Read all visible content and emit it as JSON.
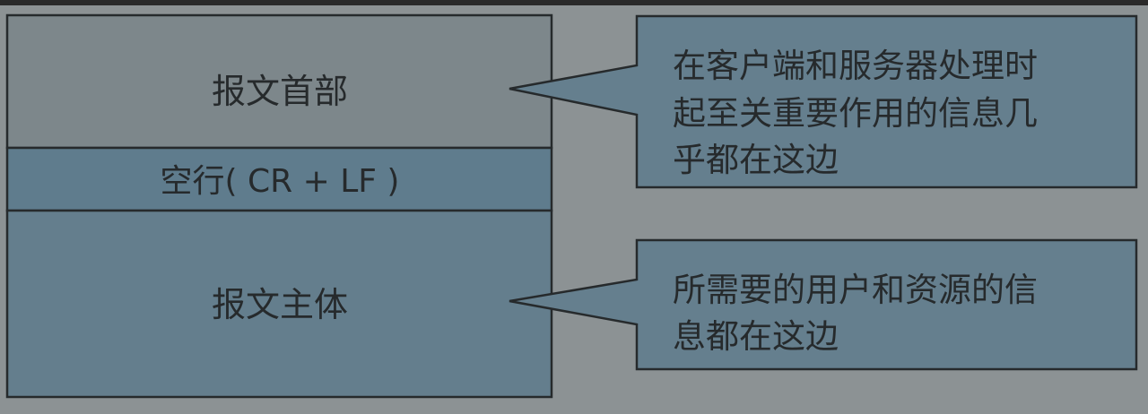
{
  "message_structure": {
    "header_label": "报文首部",
    "blank_line_label": "空行( CR + LF )",
    "body_label": "报文主体"
  },
  "callouts": {
    "header_note": {
      "lines": [
        "在客户端和服务器处理时",
        "起至关重要作用的信息几",
        "乎都在这边"
      ]
    },
    "body_note": {
      "lines": [
        "所需要的用户和资源的信",
        "息都在这边"
      ]
    }
  },
  "colors": {
    "header_fill": "#7d878b",
    "blank_line_fill": "#5f7c8d",
    "body_fill": "#647e8d",
    "callout_fill": "#657f8e",
    "outline": "#262a2c",
    "text": "#262a2c"
  }
}
